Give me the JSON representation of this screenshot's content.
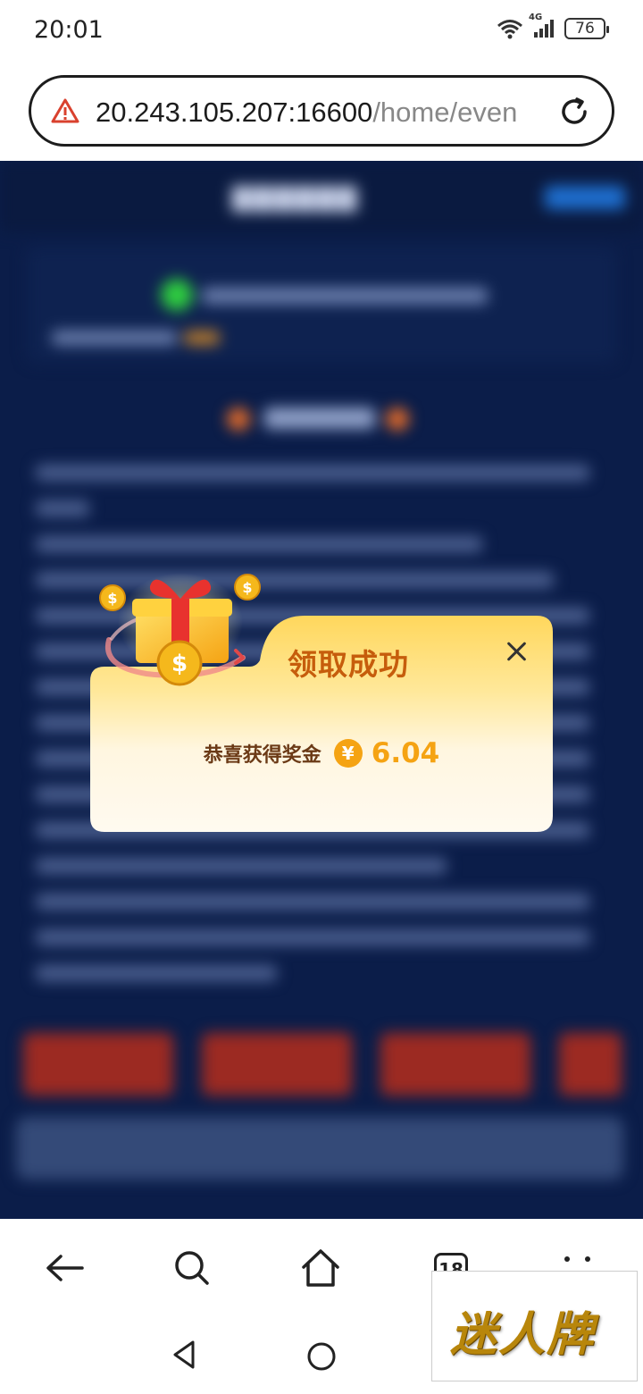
{
  "status_bar": {
    "time": "20:01",
    "network": "4G",
    "battery": "76"
  },
  "address_bar": {
    "url_host": "20.243.105.207:16600",
    "url_path": "/home/even"
  },
  "modal": {
    "title": "领取成功",
    "reward_label": "恭喜获得奖金",
    "currency_symbol": "¥",
    "amount": "6.04"
  },
  "toolbar": {
    "tab_count": "18"
  },
  "watermark": {
    "text": "迷人牌"
  }
}
